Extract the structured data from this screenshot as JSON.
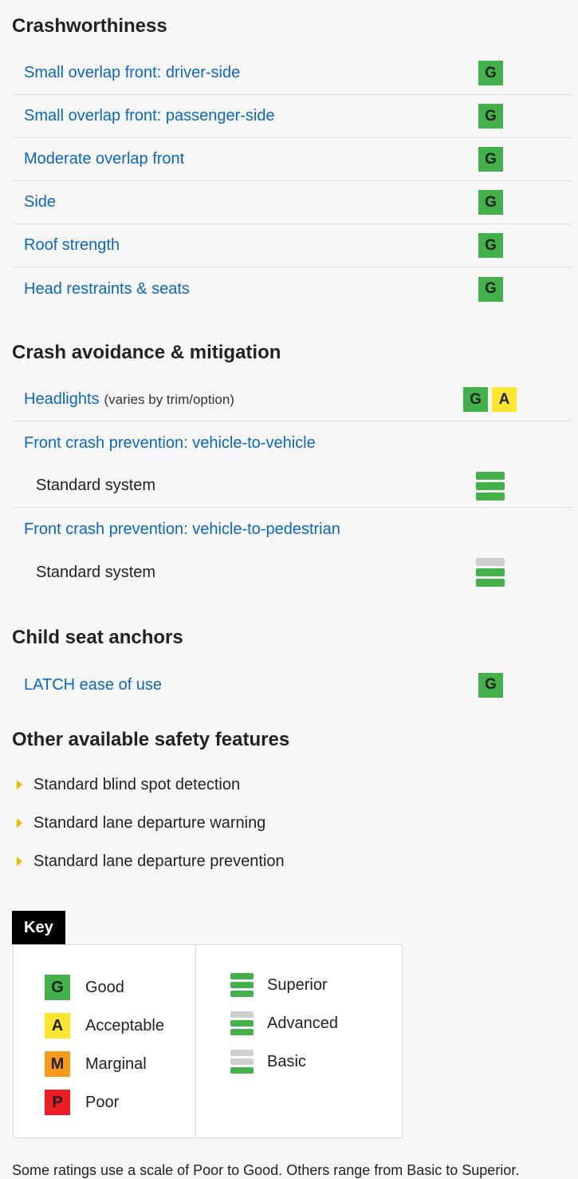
{
  "crashworthiness": {
    "title": "Crashworthiness",
    "rows": [
      {
        "label": "Small overlap front: driver-side",
        "rating": "G"
      },
      {
        "label": "Small overlap front: passenger-side",
        "rating": "G"
      },
      {
        "label": "Moderate overlap front",
        "rating": "G"
      },
      {
        "label": "Side",
        "rating": "G"
      },
      {
        "label": "Roof strength",
        "rating": "G"
      },
      {
        "label": "Head restraints & seats",
        "rating": "G"
      }
    ]
  },
  "crash_avoidance": {
    "title": "Crash avoidance & mitigation",
    "headlights": {
      "label": "Headlights",
      "note": "(varies by trim/option)",
      "ratings": [
        "G",
        "A"
      ]
    },
    "v2v": {
      "label": "Front crash prevention: vehicle-to-vehicle",
      "system_label": "Standard system",
      "level": "Superior"
    },
    "v2p": {
      "label": "Front crash prevention: vehicle-to-pedestrian",
      "system_label": "Standard system",
      "level": "Advanced"
    }
  },
  "child_seat": {
    "title": "Child seat anchors",
    "latch": {
      "label": "LATCH ease of use",
      "rating": "G"
    }
  },
  "other_features": {
    "title": "Other available safety features",
    "items": [
      "Standard blind spot detection",
      "Standard lane departure warning",
      "Standard lane departure prevention"
    ]
  },
  "key": {
    "title": "Key",
    "letter_ratings": [
      {
        "letter": "G",
        "label": "Good"
      },
      {
        "letter": "A",
        "label": "Acceptable"
      },
      {
        "letter": "M",
        "label": "Marginal"
      },
      {
        "letter": "P",
        "label": "Poor"
      }
    ],
    "levels": [
      {
        "label": "Superior",
        "filled": 3
      },
      {
        "label": "Advanced",
        "filled": 2
      },
      {
        "label": "Basic",
        "filled": 1
      }
    ]
  },
  "footnote": "Some ratings use a scale of Poor to Good. Others range from Basic to Superior.",
  "colors": {
    "good": "#43b149",
    "acceptable": "#fde530",
    "marginal": "#f89a1a",
    "poor": "#ee1c24",
    "link": "#0a67c4",
    "bar_off": "#cfcfcf"
  }
}
